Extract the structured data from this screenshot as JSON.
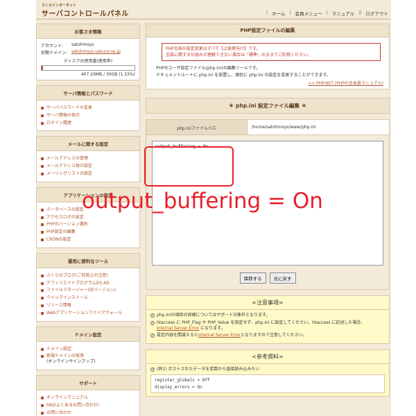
{
  "header": {
    "logo_small": "さくらインターネット",
    "logo_big": "サーバコントロールパネル",
    "nav": [
      "ホーム",
      "会員メニュー",
      "マニュアル",
      "ログアウト"
    ]
  },
  "sidebar": {
    "customer": {
      "title": "お客さま情報",
      "account_label": "アカウント:",
      "account_value": "satohmsys",
      "domain_label": "初期ドメイン:",
      "domain_value": "satohmsys.sakura.ne.jp",
      "disk_label": "ディスクの使用量(使用率)",
      "disk_value": "407.20MB / 30GB (1.33%)",
      "disk_fraction": 0.0133
    },
    "server": {
      "title": "サーバ情報とパスワード",
      "items": [
        "サーバパスワードの変更",
        "サーバ情報の表示",
        "ログイン履歴"
      ]
    },
    "mail": {
      "title": "メールに関する設定",
      "items": [
        "メールアドレスの管理",
        "メールアドレス毎の設定",
        "メーリングリストの設定"
      ]
    },
    "app": {
      "title": "アプリケーションの設定",
      "items": [
        "データベースの設定",
        "アクセスログの設定",
        "PHPのバージョン選択",
        "PHP設定の編集",
        "CRONの設定"
      ]
    },
    "tools": {
      "title": "運用に便利なツール",
      "items": [
        "さくらのブログ",
        "アフィリエイトプログラムDS AD",
        "ファイルマネージャー",
        "クイックインストール",
        "リソース情報",
        "Webアプリケーションファイアウォール"
      ],
      "subs": [
        "(ご利用上の注意)",
        "(旧バージョン)"
      ]
    },
    "domain": {
      "title": "ドメイン設定",
      "items": [
        "ドメイン設定",
        "新規ドメインの取得"
      ],
      "sub": "(オンラインサインアップ)"
    },
    "support": {
      "title": "サポート",
      "items": [
        "オンラインマニュアル",
        "FAQ(よくあるお問い合わせ)",
        "お問い合わせ"
      ]
    }
  },
  "main": {
    "panel_title": "PHP設定ファイルの編集",
    "notice_line1": "PHP言語の設定変更はすべて【上級者向け】です。",
    "notice_line2": "言語に関する仕組みが理解できない場合は「標準」のままでご利用ください。",
    "desc_line1": "PHPのユーザ設定ファイル(php.ini)の編集ツールです。",
    "desc_line2": "ドキュメントルートに php.ini を設置し、個別に php.ini の設定を変更することができます。",
    "link_text": ">> PHP.NET (PHPの日本語マニュアル)",
    "section_title": "＊ php.ini 設定ファイル編集 ＊",
    "file_label": "php.iniファイルパス",
    "file_path": "/home/satohmsys/www/php.ini",
    "ini_content": "output_buffering = On",
    "save_button": "保存する",
    "reset_button": "元に戻す",
    "notes": {
      "title": "<注意事項>",
      "line1": "php.iniの項目の詳細についてはサポート対象外となります。",
      "line2a": "htaccess に PHP_Flag や PHP_Value を指定せず、php.ini に設定してください。htaccess に記述した場合、",
      "line2b": "Internal Server Error",
      "line2c": "になります。",
      "line3a": "設定内容を間違えると",
      "line3b": "Internal Server Error",
      "line3c": "となりますので注意してください。"
    },
    "reference": {
      "title": "<参考資料>",
      "example_label": "(例1) ポストされたデータを変数から直接読み込みたい",
      "code_lines": [
        "register_globals = Off",
        "display_errors = On"
      ]
    }
  },
  "annotation": {
    "label": "output_buffering = On",
    "color": "#e8202a"
  }
}
